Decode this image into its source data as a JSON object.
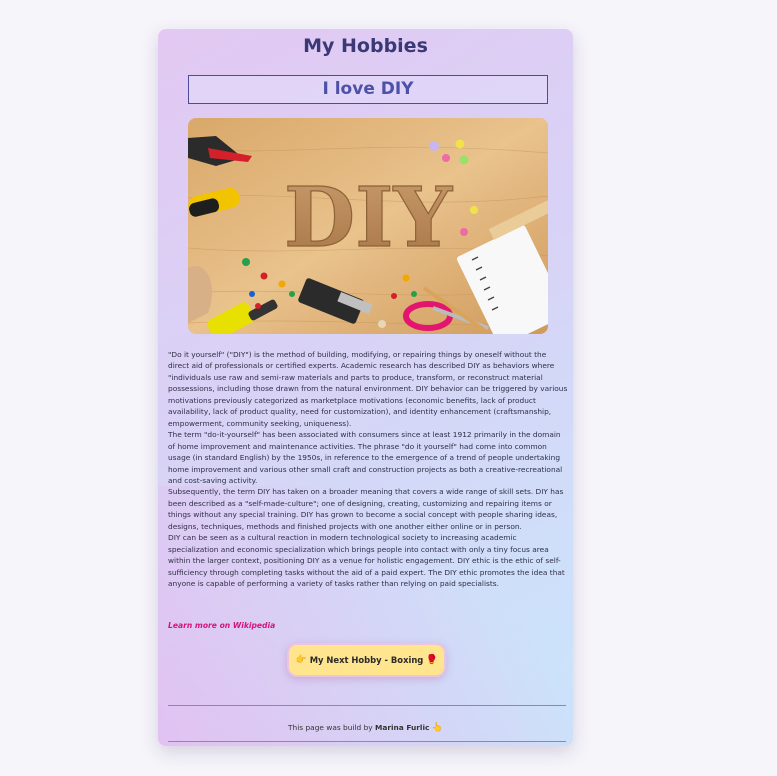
{
  "page": {
    "title": "My Hobbies",
    "subtitle": "I love DIY"
  },
  "hero": {
    "image_label": "DIY"
  },
  "article": {
    "paragraphs": [
      "\"Do it yourself\" (\"DIY\") is the method of building, modifying, or repairing things by oneself without the direct aid of professionals or certified experts. Academic research has described DIY as behaviors where \"individuals use raw and semi-raw materials and parts to produce, transform, or reconstruct material possessions, including those drawn from the natural environment. DIY behavior can be triggered by various motivations previously categorized as marketplace motivations (economic benefits, lack of product availability, lack of product quality, need for customization), and identity enhancement (craftsmanship, empowerment, community seeking, uniqueness).",
      "The term \"do-it-yourself\" has been associated with consumers since at least 1912 primarily in the domain of home improvement and maintenance activities. The phrase \"do it yourself\" had come into common usage (in standard English) by the 1950s, in reference to the emergence of a trend of people undertaking home improvement and various other small craft and construction projects as both a creative-recreational and cost-saving activity.",
      "Subsequently, the term DIY has taken on a broader meaning that covers a wide range of skill sets. DIY has been described as a \"self-made-culture\"; one of designing, creating, customizing and repairing items or things without any special training. DIY has grown to become a social concept with people sharing ideas, designs, techniques, methods and finished projects with one another either online or in person.",
      "DIY can be seen as a cultural reaction in modern technological society to increasing academic specialization and economic specialization which brings people into contact with only a tiny focus area within the larger context, positioning DIY as a venue for holistic engagement. DIY ethic is the ethic of self-sufficiency through completing tasks without the aid of a paid expert. The DIY ethic promotes the idea that anyone is capable of performing a variety of tasks rather than relying on paid specialists."
    ],
    "link_label": "Learn more on Wikipedia"
  },
  "next_button": {
    "leading_icon": "👉",
    "label": "My Next Hobby - Boxing",
    "trailing_icon": "🥊"
  },
  "footer": {
    "prefix": "This page was build by ",
    "author": "Marina Furlic",
    "icon": "👆"
  },
  "colors": {
    "title": "#3a3875",
    "subtitle": "#4e51a8",
    "link": "#d4137c",
    "button_bg": "#ffe58e"
  }
}
